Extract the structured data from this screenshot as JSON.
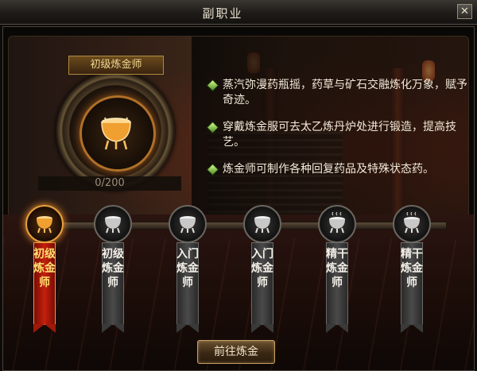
{
  "window": {
    "title": "副职业",
    "close_label": "✕"
  },
  "profession": {
    "title": "初级炼金师",
    "progress_text": "0/200",
    "progress_value": 0,
    "progress_max": 200
  },
  "descriptions": [
    "蒸汽弥漫药瓶摇，药草与矿石交融炼化万象，赋予奇迹。",
    "穿戴炼金服可去太乙炼丹炉处进行锻造，提高技艺。",
    "炼金师可制作各种回复药品及特殊状态药。"
  ],
  "ranks": [
    {
      "label": "初级炼金师",
      "active": true
    },
    {
      "label": "初级炼金师",
      "active": false
    },
    {
      "label": "入门炼金师",
      "active": false
    },
    {
      "label": "入门炼金师",
      "active": false
    },
    {
      "label": "精干炼金师",
      "active": false
    },
    {
      "label": "精干炼金师",
      "active": false
    }
  ],
  "action": {
    "label": "前往炼金"
  },
  "colors": {
    "accent": "#e8a040",
    "active_banner": "#c4200c",
    "bullet": "#8ac040"
  }
}
